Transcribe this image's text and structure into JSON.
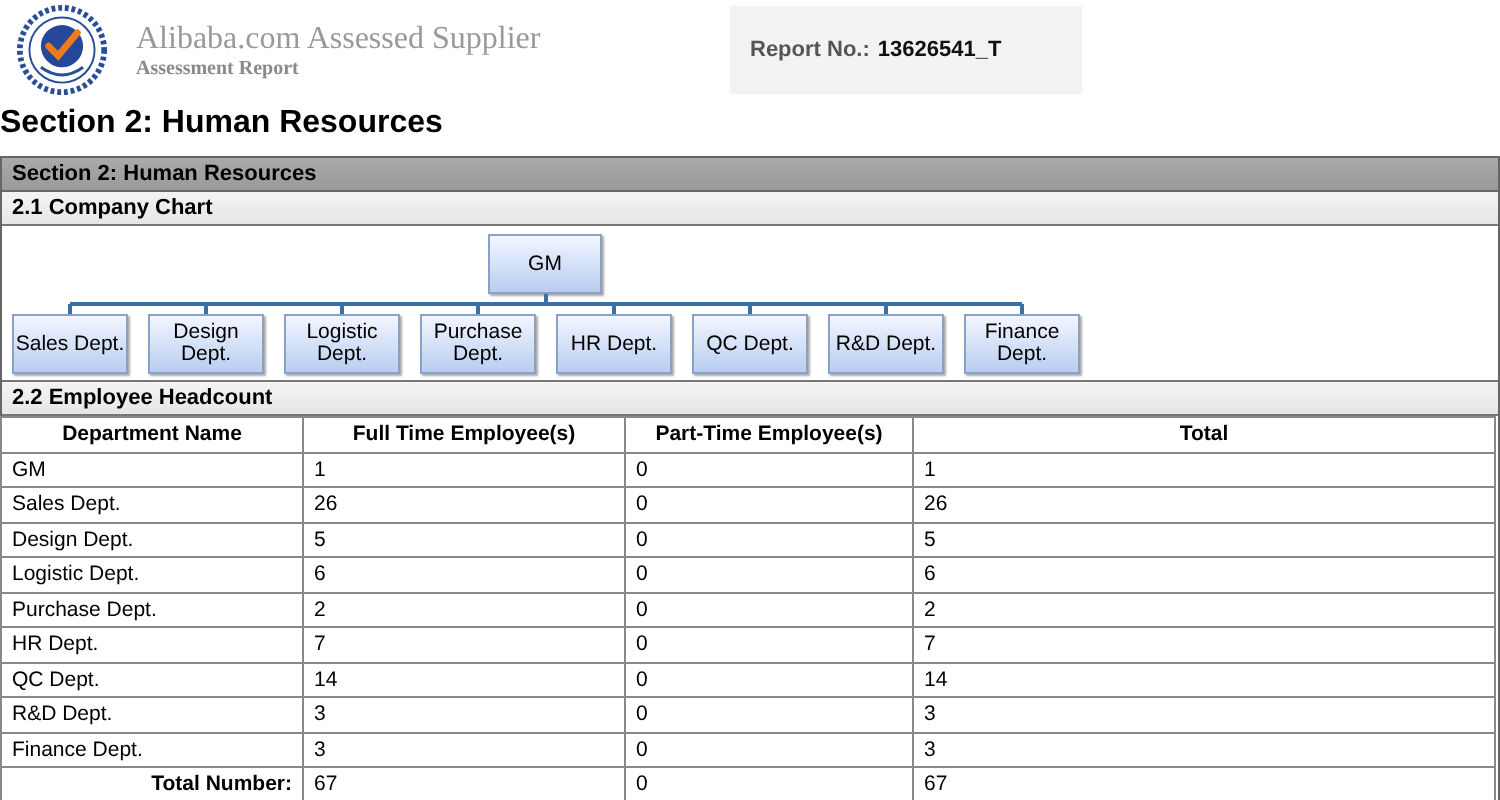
{
  "header": {
    "brand": "Alibaba.com Assessed Supplier",
    "subtitle": "Assessment Report",
    "report_label": "Report No.:",
    "report_number": "13626541_T"
  },
  "page_title": "Section 2: Human Resources",
  "section_bar": "Section 2: Human Resources",
  "company_chart": {
    "title": "2.1 Company Chart",
    "root": "GM",
    "departments": [
      "Sales Dept.",
      "Design Dept.",
      "Logistic Dept.",
      "Purchase Dept.",
      "HR Dept.",
      "QC Dept.",
      "R&D Dept.",
      "Finance Dept."
    ]
  },
  "headcount": {
    "title": "2.2 Employee Headcount",
    "columns": [
      "Department Name",
      "Full Time Employee(s)",
      "Part-Time Employee(s)",
      "Total"
    ],
    "rows": [
      [
        "GM",
        "1",
        "0",
        "1"
      ],
      [
        "Sales Dept.",
        "26",
        "0",
        "26"
      ],
      [
        "Design Dept.",
        "5",
        "0",
        "5"
      ],
      [
        "Logistic Dept.",
        "6",
        "0",
        "6"
      ],
      [
        "Purchase Dept.",
        "2",
        "0",
        "2"
      ],
      [
        "HR Dept.",
        "7",
        "0",
        "7"
      ],
      [
        "QC Dept.",
        "14",
        "0",
        "14"
      ],
      [
        "R&D Dept.",
        "3",
        "0",
        "3"
      ],
      [
        "Finance Dept.",
        "3",
        "0",
        "3"
      ]
    ],
    "total_row": [
      "Total Number:",
      "67",
      "0",
      "67"
    ]
  }
}
